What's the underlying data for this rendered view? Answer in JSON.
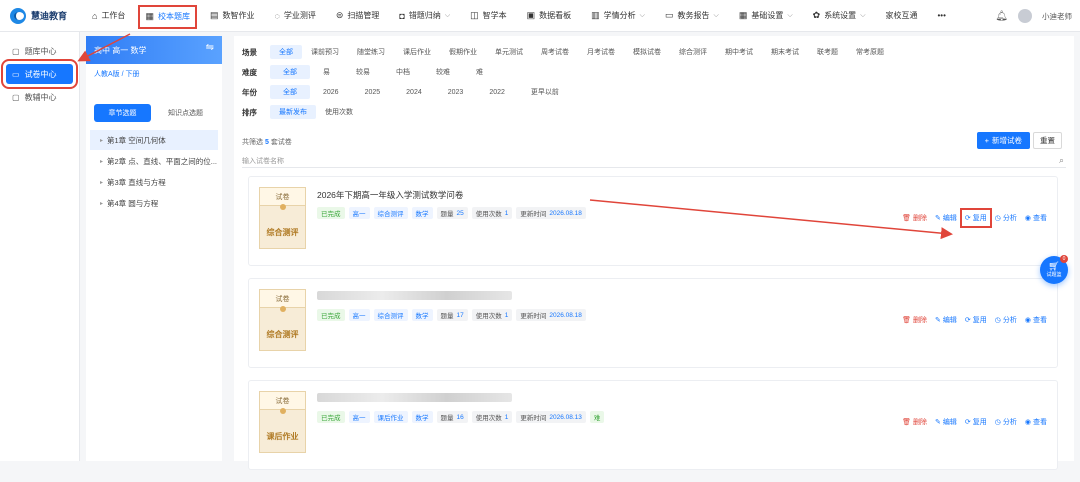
{
  "brand": {
    "name": "慧迪教育"
  },
  "nav": [
    {
      "icon": "home-icon",
      "glyph": "⌂",
      "label": "工作台"
    },
    {
      "icon": "library-icon",
      "glyph": "▦",
      "label": "校本题库"
    },
    {
      "icon": "homework-icon",
      "glyph": "▤",
      "label": "数智作业"
    },
    {
      "icon": "assessment-icon",
      "glyph": "◌",
      "label": "学业测评"
    },
    {
      "icon": "scan-icon",
      "glyph": "⊜",
      "label": "扫描管理"
    },
    {
      "icon": "wrongbook-icon",
      "glyph": "◘",
      "label": "错题归纳",
      "caret": "⌵"
    },
    {
      "icon": "smartbook-icon",
      "glyph": "◫",
      "label": "智学本"
    },
    {
      "icon": "dashboard-icon",
      "glyph": "▣",
      "label": "数据看板"
    },
    {
      "icon": "analysis-icon",
      "glyph": "▥",
      "label": "学情分析",
      "caret": "⌵"
    },
    {
      "icon": "folder-icon",
      "glyph": "▭",
      "label": "教务报告",
      "caret": "⌵"
    },
    {
      "icon": "settings-basic-icon",
      "glyph": "▦",
      "label": "基础设置",
      "caret": "⌵"
    },
    {
      "icon": "gear-icon",
      "glyph": "✿",
      "label": "系统设置",
      "caret": "⌵"
    },
    {
      "icon": "",
      "glyph": "",
      "label": "家校互通"
    },
    {
      "icon": "more-icon",
      "glyph": "",
      "label": "•••"
    }
  ],
  "user": {
    "name": "小迪老师"
  },
  "sidebar": [
    {
      "label": "题库中心"
    },
    {
      "label": "试卷中心"
    },
    {
      "label": "教辅中心"
    }
  ],
  "tree": {
    "header": "高中 高一 数学",
    "edition": "人教A版 / 下册",
    "tabs": [
      "章节选题",
      "知识点选题"
    ],
    "chapters": [
      "第1章 空间几何体",
      "第2章 点、直线、平面之间的位...",
      "第3章 直线与方程",
      "第4章 圆与方程"
    ]
  },
  "filters": {
    "scene": {
      "label": "场景",
      "options": [
        "全部",
        "课前预习",
        "随堂练习",
        "课后作业",
        "假期作业",
        "单元测试",
        "周考试卷",
        "月考试卷",
        "模拟试卷",
        "综合测评",
        "期中考试",
        "期末考试",
        "联考题",
        "常考原题"
      ]
    },
    "difficulty": {
      "label": "难度",
      "options": [
        "全部",
        "易",
        "较易",
        "中档",
        "较难",
        "难"
      ]
    },
    "year": {
      "label": "年份",
      "options": [
        "全部",
        "2026",
        "2025",
        "2024",
        "2023",
        "2022",
        "更早以前"
      ]
    },
    "sort": {
      "label": "排序",
      "options": [
        "最新发布",
        "使用次数"
      ]
    }
  },
  "results": {
    "prefix": "共筛选",
    "count": "5",
    "suffix": "套试卷"
  },
  "buttons": {
    "add": "新增试卷",
    "reset": "重置"
  },
  "search": {
    "placeholder": "输入试卷名称"
  },
  "cards": [
    {
      "thumb_top": "试卷",
      "thumb_label": "综合测评",
      "title": "2026年下期高一年级入学测试数学问卷",
      "title_blurred": false,
      "status": "已完成",
      "tags": [
        "高一",
        "综合测评",
        "数学"
      ],
      "stats": [
        {
          "label": "题量",
          "value": "25"
        },
        {
          "label": "使用次数",
          "value": "1"
        },
        {
          "label": "更新时间",
          "value": "2026.08.18"
        }
      ],
      "extra_tag": ""
    },
    {
      "thumb_top": "试卷",
      "thumb_label": "综合测评",
      "title": "",
      "title_blurred": true,
      "status": "已完成",
      "tags": [
        "高一",
        "综合测评",
        "数学"
      ],
      "stats": [
        {
          "label": "题量",
          "value": "17"
        },
        {
          "label": "使用次数",
          "value": "1"
        },
        {
          "label": "更新时间",
          "value": "2026.08.18"
        }
      ],
      "extra_tag": ""
    },
    {
      "thumb_top": "试卷",
      "thumb_label": "课后作业",
      "title": "",
      "title_blurred": true,
      "status": "已完成",
      "tags": [
        "高一",
        "课后作业",
        "数学"
      ],
      "stats": [
        {
          "label": "题量",
          "value": "16"
        },
        {
          "label": "使用次数",
          "value": "1"
        },
        {
          "label": "更新时间",
          "value": "2026.08.13"
        }
      ],
      "extra_tag": "难"
    }
  ],
  "actions": [
    {
      "icon": "trash-icon",
      "glyph": "🗑",
      "label": "删除"
    },
    {
      "icon": "edit-icon",
      "glyph": "✎",
      "label": "编辑"
    },
    {
      "icon": "reuse-icon",
      "glyph": "⟳",
      "label": "复用"
    },
    {
      "icon": "analysis-icon",
      "glyph": "◷",
      "label": "分析"
    },
    {
      "icon": "view-icon",
      "glyph": "◉",
      "label": "查看"
    }
  ],
  "cart": {
    "label": "试题篮",
    "badge": "0"
  },
  "colors": {
    "primary": "#1677ff",
    "annotation": "#e0453a"
  }
}
